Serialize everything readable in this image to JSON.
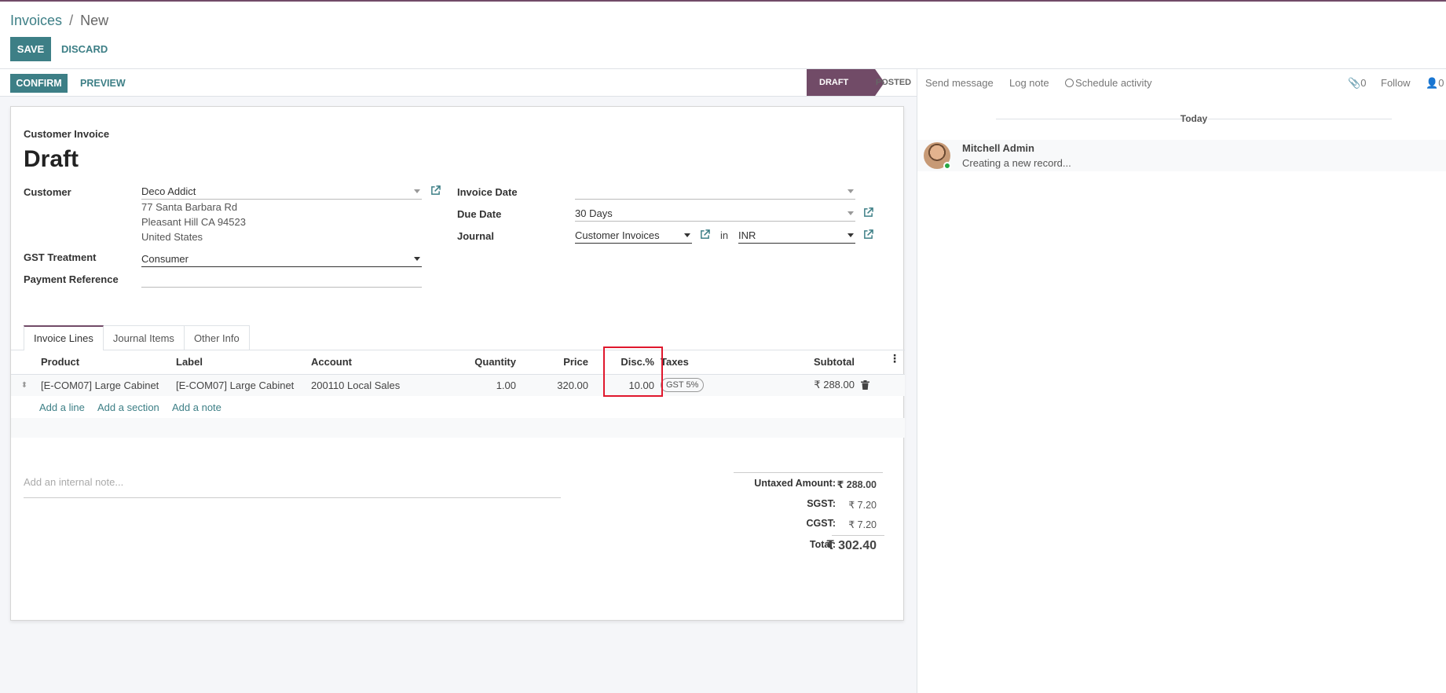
{
  "breadcrumb": {
    "parent": "Invoices",
    "separator": "/",
    "current": "New"
  },
  "control": {
    "save_label": "SAVE",
    "discard_label": "DISCARD"
  },
  "statusbar": {
    "confirm_label": "CONFIRM",
    "preview_label": "PREVIEW",
    "stages": [
      "DRAFT",
      "POSTED"
    ],
    "active_stage": "DRAFT"
  },
  "sheet": {
    "subtitle": "Customer Invoice",
    "title": "Draft",
    "customer": {
      "label": "Customer",
      "value": "Deco Addict",
      "address": [
        "77 Santa Barbara Rd",
        "Pleasant Hill CA 94523",
        "United States"
      ]
    },
    "gst_treatment": {
      "label": "GST Treatment",
      "value": "Consumer"
    },
    "payment_reference": {
      "label": "Payment Reference",
      "value": ""
    },
    "invoice_date": {
      "label": "Invoice Date",
      "value": ""
    },
    "due_date": {
      "label": "Due Date",
      "value": "30 Days"
    },
    "journal": {
      "label": "Journal",
      "value": "Customer Invoices",
      "in_label": "in",
      "currency": "INR"
    }
  },
  "tabs": [
    "Invoice Lines",
    "Journal Items",
    "Other Info"
  ],
  "lines": {
    "headers": [
      "Product",
      "Label",
      "Account",
      "Quantity",
      "Price",
      "Disc.%",
      "Taxes",
      "Subtotal"
    ],
    "rows": [
      {
        "product": "[E-COM07] Large Cabinet",
        "label": "[E-COM07] Large Cabinet",
        "account": "200110 Local Sales",
        "quantity": "1.00",
        "price": "320.00",
        "discount": "10.00",
        "tax": "GST 5%",
        "subtotal": "₹ 288.00"
      }
    ],
    "actions": [
      "Add a line",
      "Add a section",
      "Add a note"
    ]
  },
  "note_placeholder": "Add an internal note...",
  "totals": {
    "untaxed_label": "Untaxed Amount:",
    "untaxed_value": "₹ 288.00",
    "sgst_label": "SGST:",
    "sgst_value": "₹ 7.20",
    "cgst_label": "CGST:",
    "cgst_value": "₹ 7.20",
    "total_label": "Total:",
    "total_value": "₹ 302.40"
  },
  "chatter": {
    "send_message": "Send message",
    "log_note": "Log note",
    "schedule_activity": "Schedule activity",
    "attachments_count": "0",
    "follow": "Follow",
    "followers_count": "0",
    "date_separator": "Today",
    "message": {
      "author": "Mitchell Admin",
      "body": "Creating a new record..."
    }
  },
  "colors": {
    "primary": "#3d7f86",
    "brand": "#714B67",
    "highlight": "#e0182d"
  }
}
